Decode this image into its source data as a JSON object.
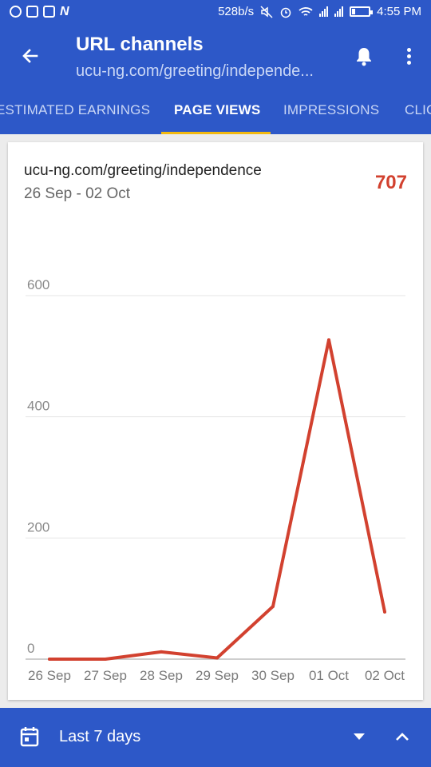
{
  "status_bar": {
    "left_icons": [
      "whatsapp-icon",
      "sim-card-icon",
      "gallery-icon",
      "n-app-icon"
    ],
    "network_speed": "528b/s",
    "time": "4:55 PM"
  },
  "app_bar": {
    "title": "URL channels",
    "subtitle": "ucu-ng.com/greeting/independe..."
  },
  "tabs": [
    {
      "label": "ESTIMATED EARNINGS",
      "active": false
    },
    {
      "label": "PAGE VIEWS",
      "active": true
    },
    {
      "label": "IMPRESSIONS",
      "active": false
    },
    {
      "label": "CLICKS",
      "active": false
    }
  ],
  "card": {
    "url": "ucu-ng.com/greeting/independence",
    "date_range": "26 Sep - 02 Oct",
    "total": "707"
  },
  "chart_data": {
    "type": "line",
    "x": [
      "26 Sep",
      "27 Sep",
      "28 Sep",
      "29 Sep",
      "30 Sep",
      "01 Oct",
      "02 Oct"
    ],
    "series": [
      {
        "values": [
          0,
          0,
          12,
          2,
          87,
          527,
          78
        ]
      }
    ],
    "y_ticks": [
      0,
      200,
      400,
      600
    ],
    "ylim": [
      0,
      600
    ],
    "grid": true,
    "line_color": "#d2412f"
  },
  "bottom_bar": {
    "range_label": "Last 7 days"
  }
}
